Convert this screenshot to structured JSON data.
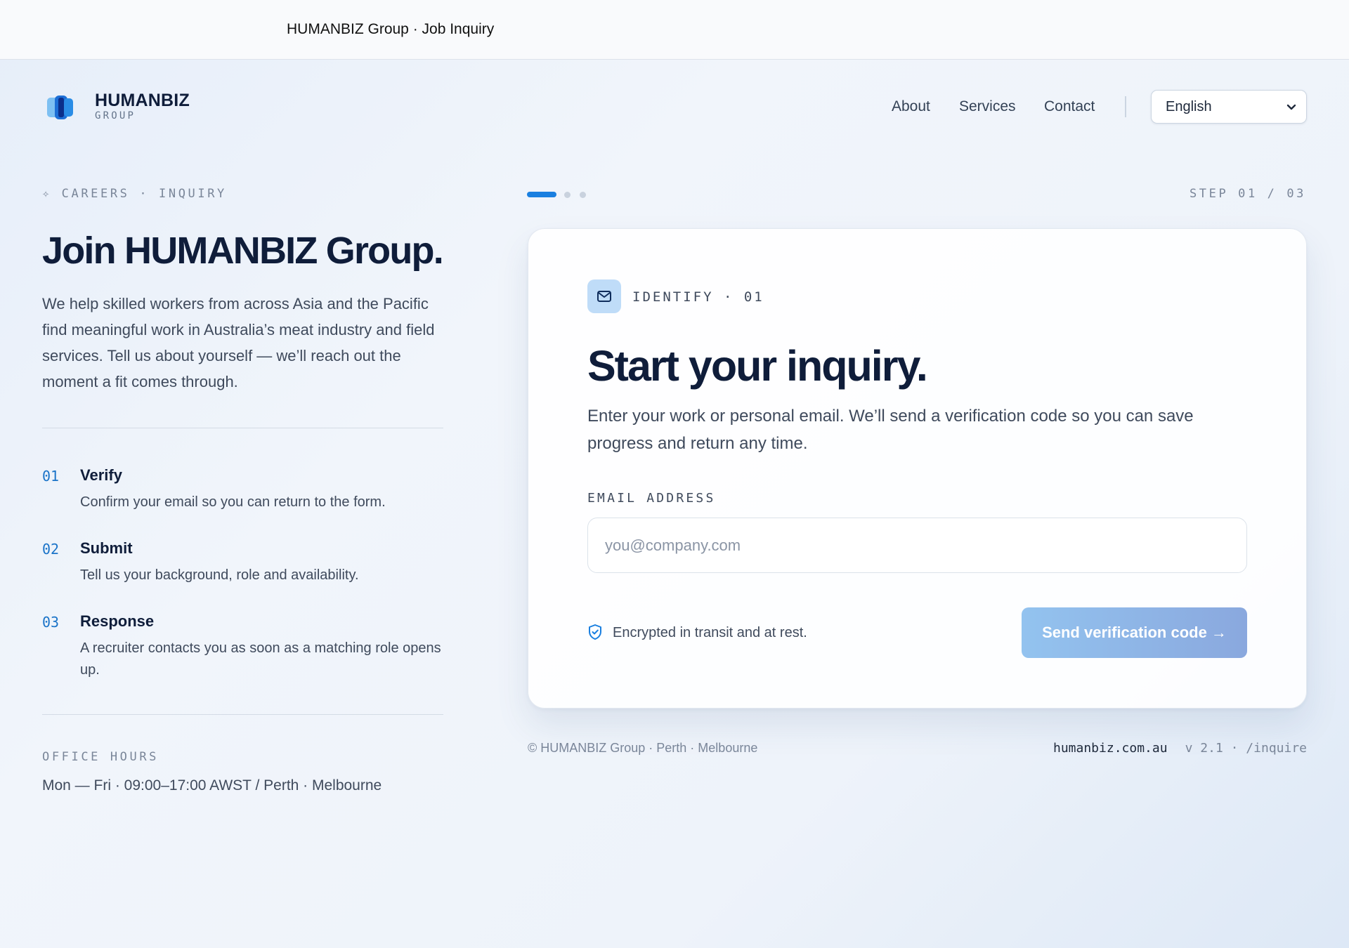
{
  "window": {
    "title": "HUMANBIZ Group · Job Inquiry"
  },
  "brand": {
    "name": "HUMANBIZ",
    "sub": "GROUP",
    "logo_icon": "humanbiz-logo-icon"
  },
  "nav": {
    "items": [
      {
        "label": "About"
      },
      {
        "label": "Services"
      },
      {
        "label": "Contact"
      }
    ],
    "language": {
      "selected": "English"
    }
  },
  "hero": {
    "eyebrow": "✧ CAREERS · INQUIRY",
    "title": "Join HUMANBIZ Group.",
    "description": "We help skilled workers from across Asia and the Pacific find meaningful work in Australia’s meat industry and field services. Tell us about yourself — we’ll reach out the moment a fit comes through."
  },
  "steps": [
    {
      "num": "01",
      "title": "Verify",
      "desc": "Confirm your email so you can return to the form."
    },
    {
      "num": "02",
      "title": "Submit",
      "desc": "Tell us your background, role and availability."
    },
    {
      "num": "03",
      "title": "Response",
      "desc": "A recruiter contacts you as soon as a matching role opens up."
    }
  ],
  "office": {
    "label": "OFFICE HOURS",
    "hours": "Mon — Fri · 09:00–17:00 AWST / Perth · Melbourne"
  },
  "progress": {
    "counter": "STEP 01 / 03",
    "current_step": 1,
    "total_steps": 3
  },
  "card": {
    "badge_icon": "mail-icon",
    "badge_label": "IDENTIFY · 01",
    "title": "Start your inquiry.",
    "description": "Enter your work or personal email. We’ll send a verification code so you can save progress and return any time.",
    "email_label": "EMAIL ADDRESS",
    "email_placeholder": "you@company.com",
    "email_value": "",
    "secure_icon": "shield-check-icon",
    "secure_text": "Encrypted in transit and at rest.",
    "submit_label": "Send verification code →"
  },
  "footer": {
    "copyright": "© HUMANBIZ Group · Perth · Melbourne",
    "domain": "humanbiz.com.au",
    "version": "v 2.1 · /inquire"
  },
  "colors": {
    "accent": "#1a7fe0",
    "heading": "#0f1d3a",
    "button_start": "#93c3ef",
    "button_end": "#8aa8de"
  }
}
